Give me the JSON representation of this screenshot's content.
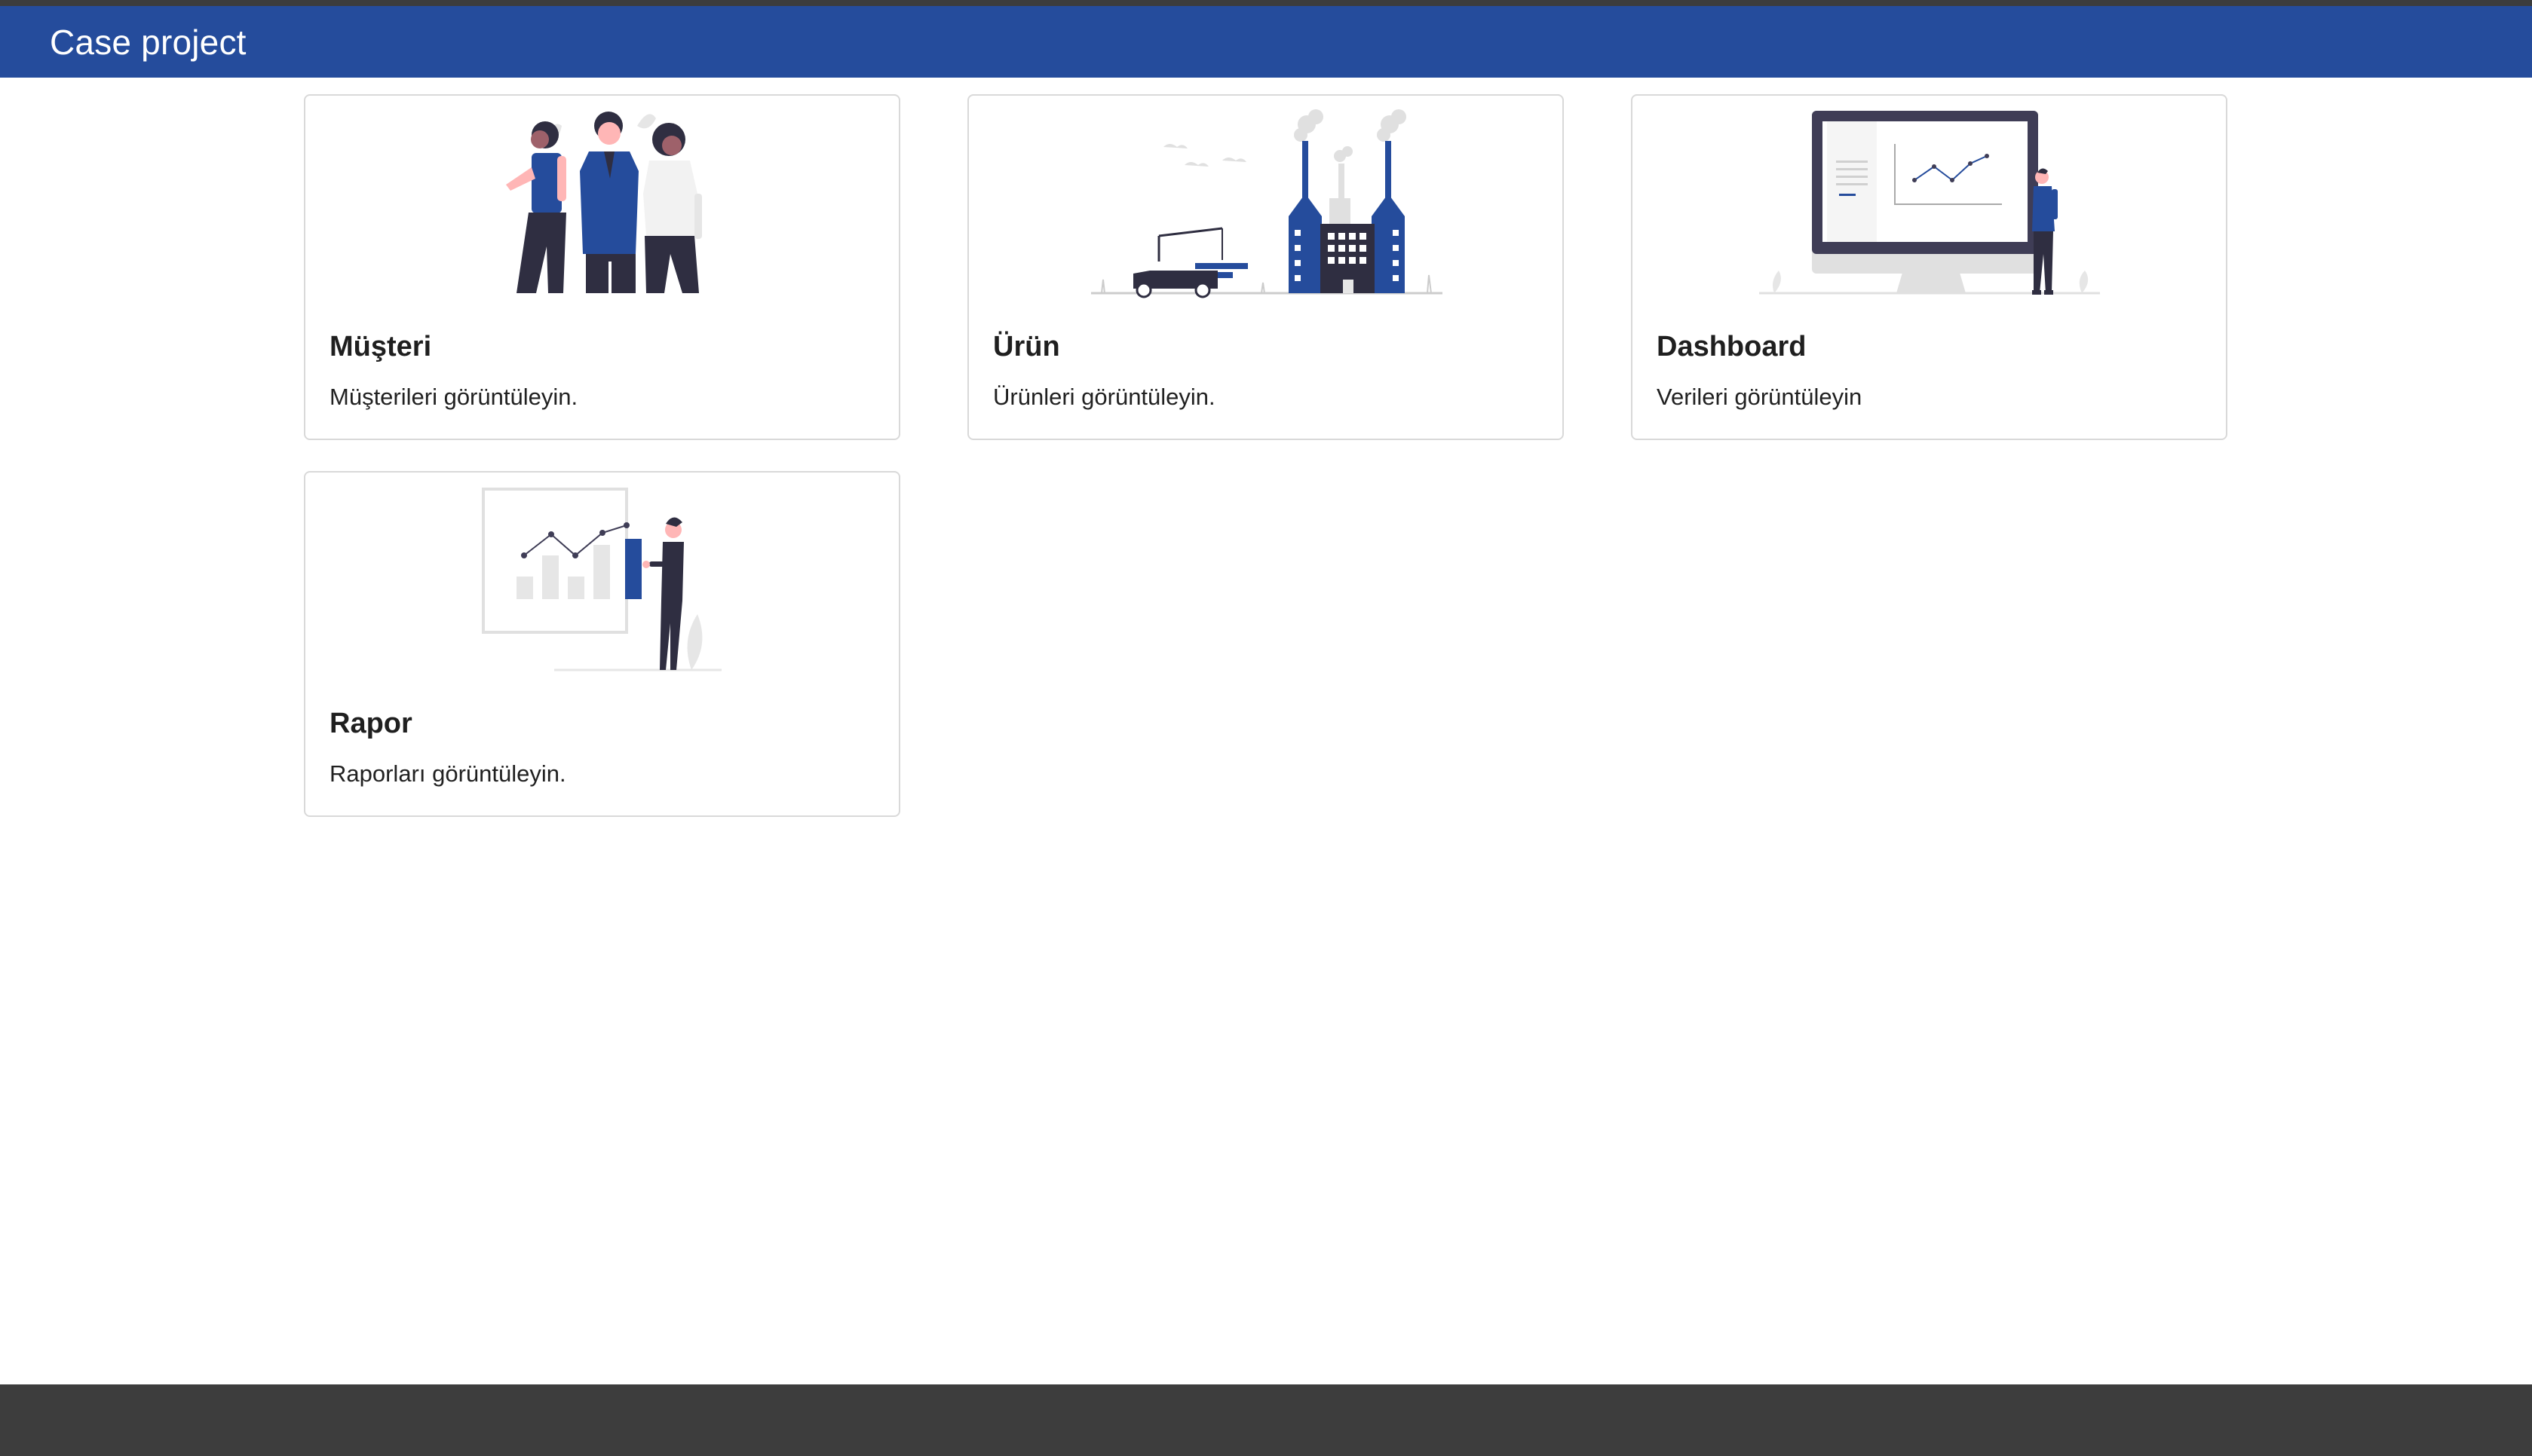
{
  "app": {
    "brand": "Case project"
  },
  "theme": {
    "primary": "#254c9c",
    "footer": "#3d3d3d",
    "dark_figure": "#2f2e41"
  },
  "cards": [
    {
      "title": "Müşteri",
      "text": "Müşterileri görüntüleyin.",
      "icon": "people-illustration"
    },
    {
      "title": "Ürün",
      "text": "Ürünleri görüntüleyin.",
      "icon": "factory-illustration"
    },
    {
      "title": "Dashboard",
      "text": "Verileri görüntüleyin",
      "icon": "monitor-dashboard-illustration"
    },
    {
      "title": "Rapor",
      "text": "Raporları görüntüleyin.",
      "icon": "report-chart-illustration"
    }
  ]
}
